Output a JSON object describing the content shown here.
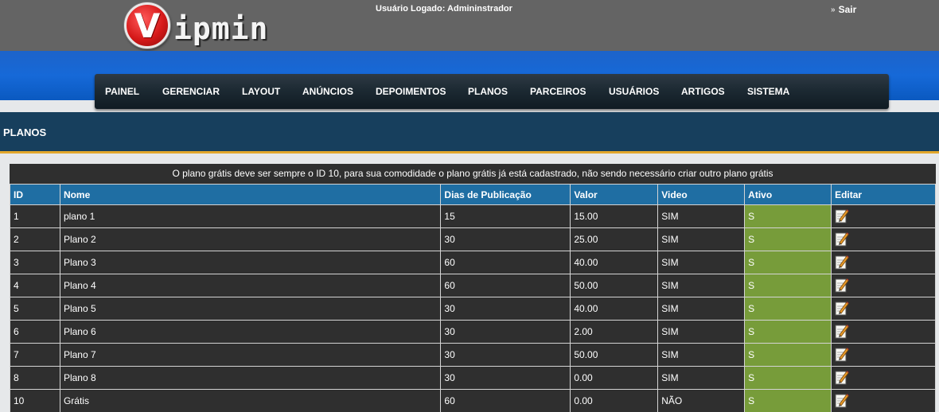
{
  "header": {
    "logo_letter": "V",
    "logo_text": "ipmin",
    "user_label": "Usuário Logado: Admininstrador",
    "logout_label": "Sair",
    "logout_chevron": "»"
  },
  "menu": [
    {
      "label": "PAINEL"
    },
    {
      "label": "GERENCIAR"
    },
    {
      "label": "LAYOUT"
    },
    {
      "label": "ANÚNCIOS"
    },
    {
      "label": "DEPOIMENTOS"
    },
    {
      "label": "PLANOS"
    },
    {
      "label": "PARCEIROS"
    },
    {
      "label": "USUÁRIOS"
    },
    {
      "label": "ARTIGOS"
    },
    {
      "label": "SISTEMA"
    }
  ],
  "section": {
    "title": "PLANOS"
  },
  "table": {
    "notice": "O plano grátis deve ser sempre o ID 10, para sua comodidade o plano grátis já está cadastrado, não sendo necessário criar outro plano grátis",
    "columns": [
      "ID",
      "Nome",
      "Dias de Publicação",
      "Valor",
      "Video",
      "Ativo",
      "Editar"
    ],
    "rows": [
      {
        "id": "1",
        "nome": "plano 1",
        "dias": "15",
        "valor": "15.00",
        "video": "SIM",
        "ativo": "S"
      },
      {
        "id": "2",
        "nome": "Plano 2",
        "dias": "30",
        "valor": "25.00",
        "video": "SIM",
        "ativo": "S"
      },
      {
        "id": "3",
        "nome": "Plano 3",
        "dias": "60",
        "valor": "40.00",
        "video": "SIM",
        "ativo": "S"
      },
      {
        "id": "4",
        "nome": "Plano 4",
        "dias": "60",
        "valor": "50.00",
        "video": "SIM",
        "ativo": "S"
      },
      {
        "id": "5",
        "nome": "Plano 5",
        "dias": "30",
        "valor": "40.00",
        "video": "SIM",
        "ativo": "S"
      },
      {
        "id": "6",
        "nome": "Plano 6",
        "dias": "30",
        "valor": "2.00",
        "video": "SIM",
        "ativo": "S"
      },
      {
        "id": "7",
        "nome": "Plano 7",
        "dias": "30",
        "valor": "50.00",
        "video": "SIM",
        "ativo": "S"
      },
      {
        "id": "8",
        "nome": "Plano 8",
        "dias": "30",
        "valor": "0.00",
        "video": "SIM",
        "ativo": "S"
      },
      {
        "id": "10",
        "nome": "Grátis",
        "dias": "60",
        "valor": "0.00",
        "video": "NÃO",
        "ativo": "S"
      }
    ],
    "edit_icon": "pencil-paper-icon"
  },
  "colors": {
    "topbar": "#646464",
    "bluebar": "#1669d8",
    "menubar": "#1d2a33",
    "section_bar": "#173f5d",
    "section_accent": "#e2a72c",
    "table_header": "#1f6ea3",
    "table_body": "#2f2f2f",
    "active_cell": "#779c3a",
    "logo_red": "#d61a1a"
  }
}
